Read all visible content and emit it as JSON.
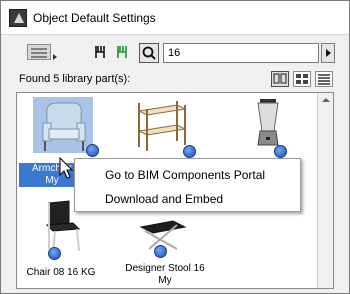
{
  "window": {
    "title": "Object Default Settings",
    "icon": "archicad-app-icon"
  },
  "toolbar": {
    "search_value": "16",
    "icons": [
      "view-mode-icon",
      "chair-black-icon",
      "chair-green-icon",
      "search-icon",
      "go-arrow-icon"
    ]
  },
  "status": {
    "found_text": "Found 5 library part(s):"
  },
  "view_modes": {
    "options": [
      "large-icons-view",
      "small-icons-view",
      "list-view"
    ],
    "selected": "large-icons-view"
  },
  "library_items": [
    {
      "label": "Armchair",
      "label_line2": "My",
      "selected": true
    },
    {
      "label": "",
      "label_line2": "",
      "selected": false
    },
    {
      "label": "",
      "label_line2": "",
      "selected": false
    },
    {
      "label": "Chair 08 16 KG",
      "label_line2": "",
      "selected": false
    },
    {
      "label": "Designer Stool 16",
      "label_line2": "My",
      "selected": false
    }
  ],
  "context_menu": {
    "items": [
      "Go to BIM Components Portal",
      "Download and Embed"
    ]
  },
  "colors": {
    "selection": "#3b79d0",
    "badge": "#2a65d0"
  }
}
